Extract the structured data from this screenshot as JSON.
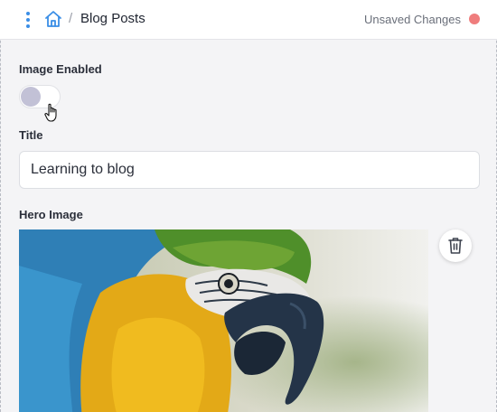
{
  "header": {
    "breadcrumb_separator": "/",
    "title": "Blog Posts",
    "status_text": "Unsaved Changes",
    "status_color": "#ef7d7d",
    "menu_icon": "kebab-menu-icon",
    "home_icon": "home-icon",
    "accent_color": "#3a8ee6"
  },
  "form": {
    "image_enabled": {
      "label": "Image Enabled",
      "state": "off"
    },
    "title": {
      "label": "Title",
      "value": "Learning to blog"
    },
    "hero_image": {
      "label": "Hero Image",
      "delete_icon": "trash-icon"
    }
  }
}
